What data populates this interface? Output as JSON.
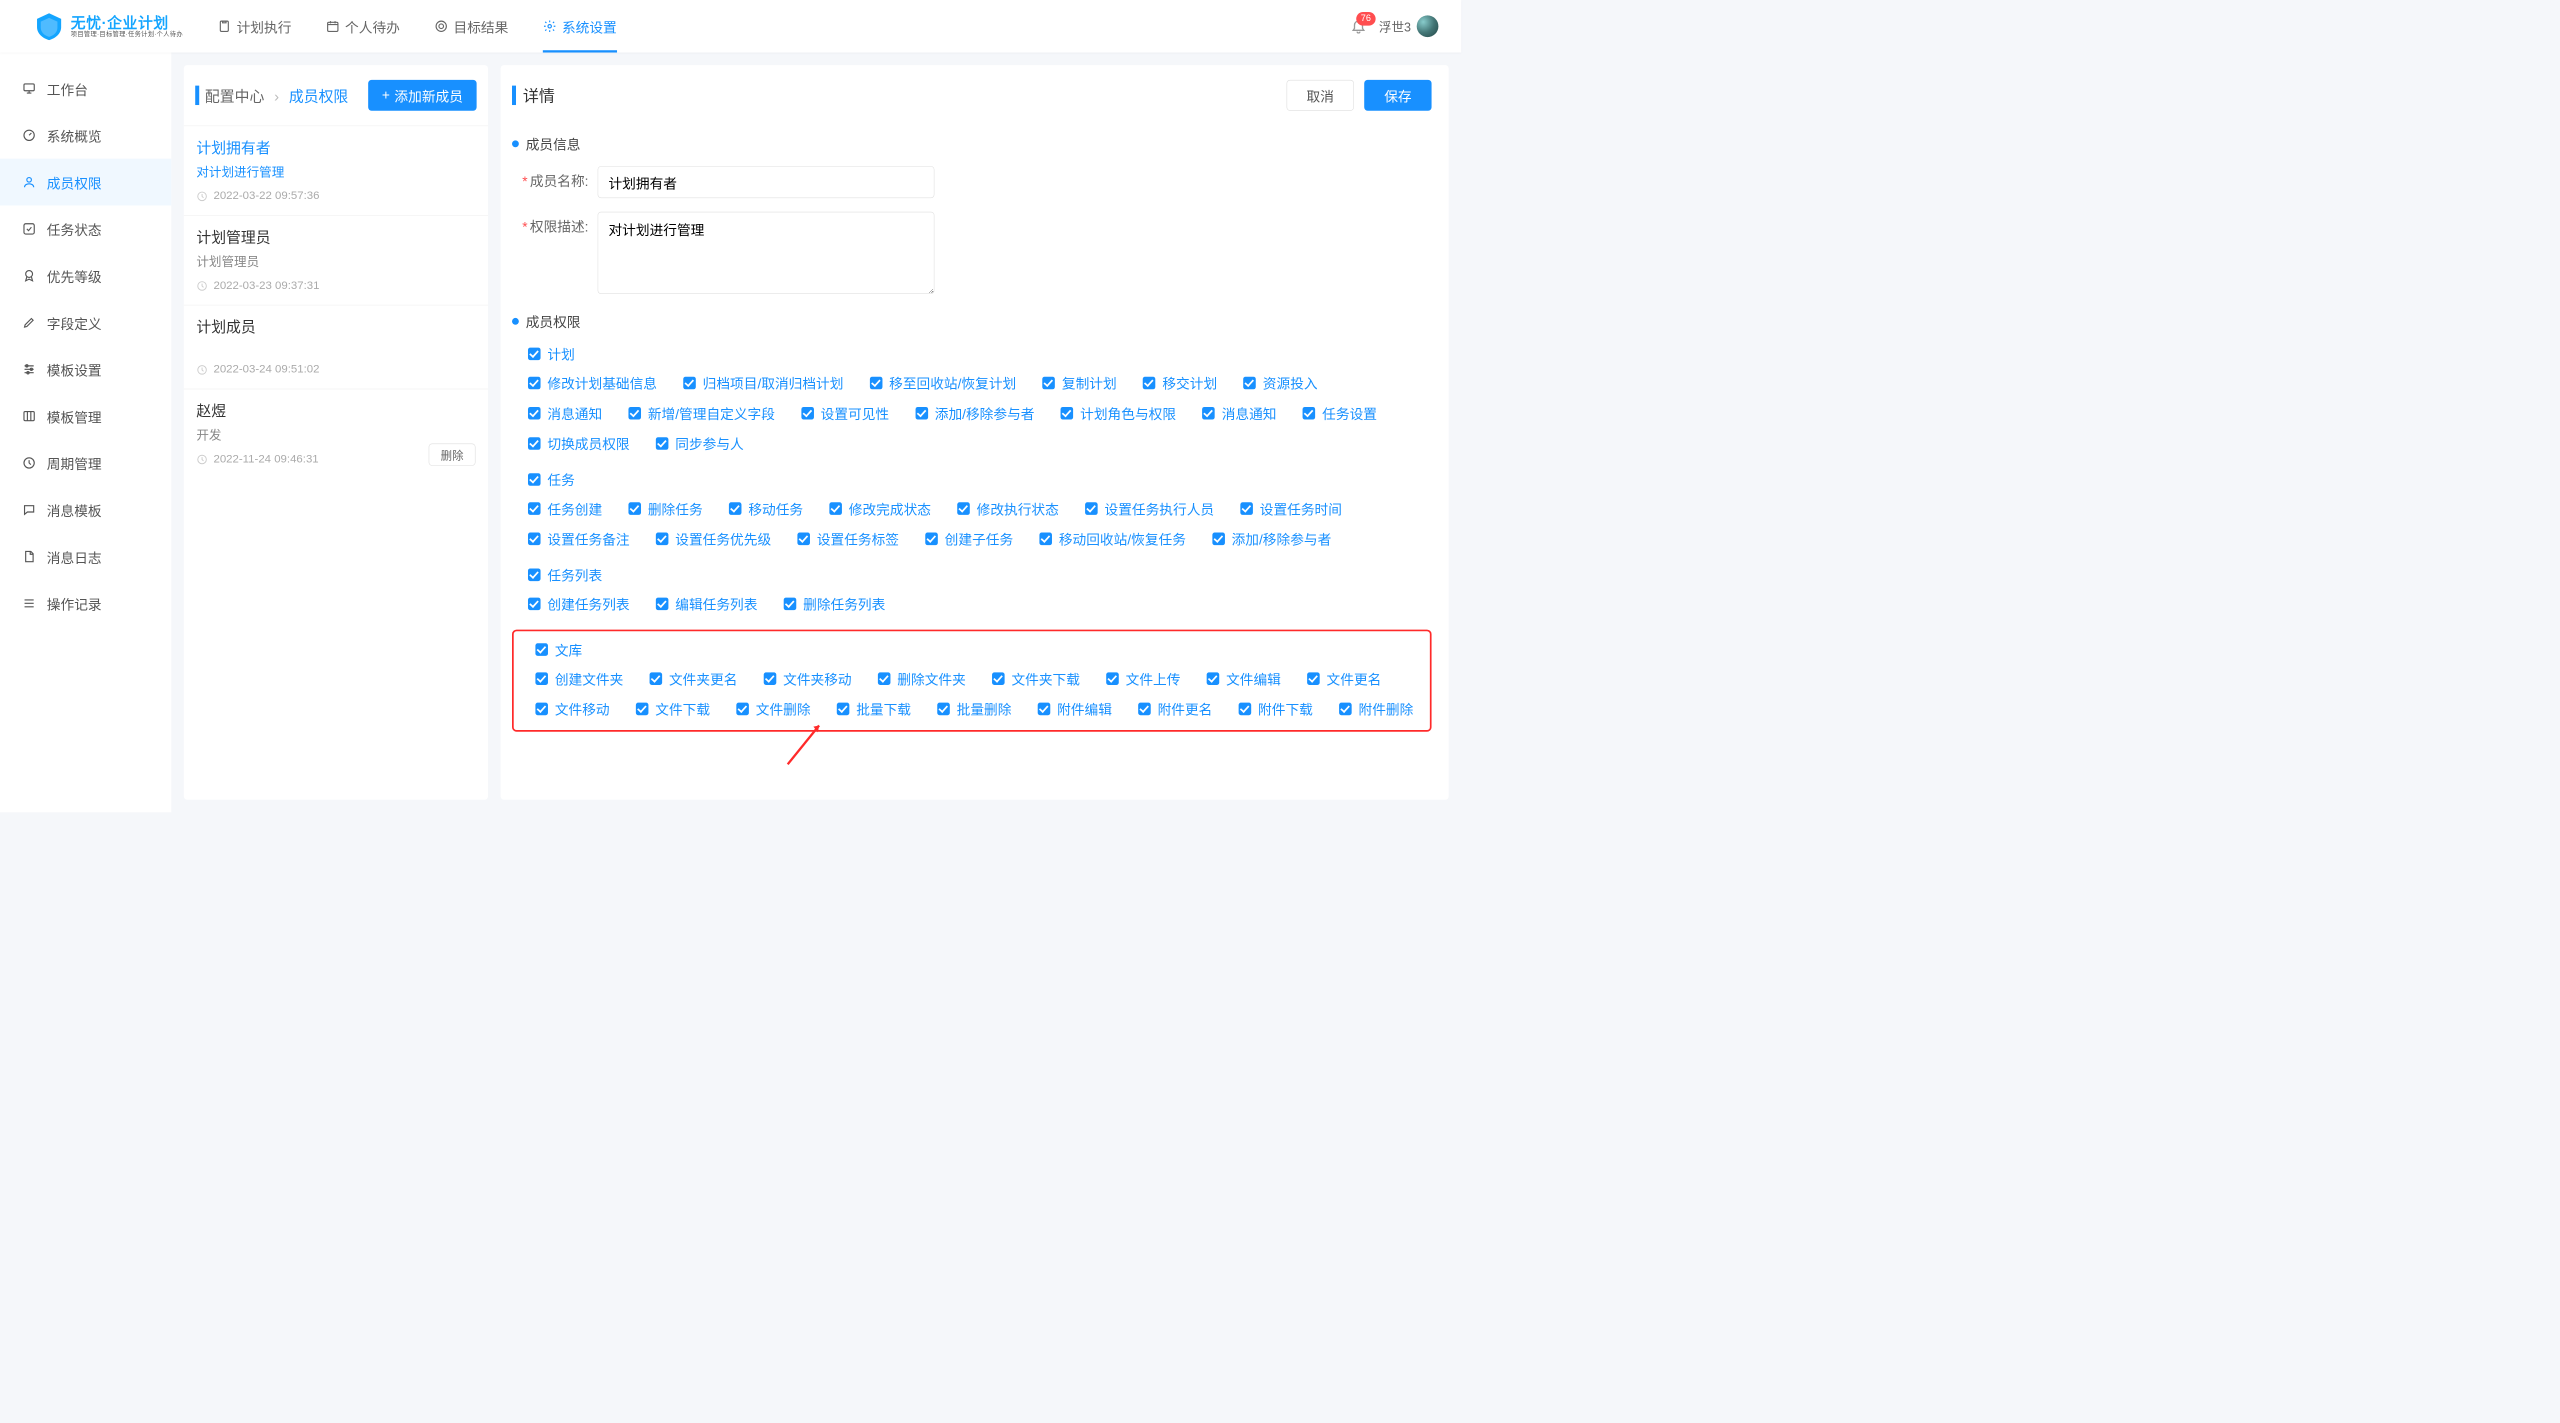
{
  "accent": "#1890ff",
  "logo": {
    "brand": "无忧·企业计划",
    "tagline": "项目管理·目标管理·任务计划·个人待办"
  },
  "topTabs": [
    {
      "id": "plan-exec",
      "label": "计划执行"
    },
    {
      "id": "personal",
      "label": "个人待办"
    },
    {
      "id": "okr",
      "label": "目标结果"
    },
    {
      "id": "settings",
      "label": "系统设置",
      "active": true
    }
  ],
  "notifications": {
    "count": "76"
  },
  "user": {
    "name": "浮世3"
  },
  "sidebar": [
    {
      "id": "workbench",
      "label": "工作台",
      "icon": "monitor"
    },
    {
      "id": "overview",
      "label": "系统概览",
      "icon": "dashboard"
    },
    {
      "id": "members",
      "label": "成员权限",
      "icon": "user",
      "active": true
    },
    {
      "id": "status",
      "label": "任务状态",
      "icon": "check-square"
    },
    {
      "id": "priority",
      "label": "优先等级",
      "icon": "medal"
    },
    {
      "id": "fields",
      "label": "字段定义",
      "icon": "pen"
    },
    {
      "id": "templates",
      "label": "模板设置",
      "icon": "sliders"
    },
    {
      "id": "tpl-mgmt",
      "label": "模板管理",
      "icon": "columns"
    },
    {
      "id": "cycles",
      "label": "周期管理",
      "icon": "clock"
    },
    {
      "id": "msg-tpl",
      "label": "消息模板",
      "icon": "chat"
    },
    {
      "id": "msg-log",
      "label": "消息日志",
      "icon": "doc"
    },
    {
      "id": "audit",
      "label": "操作记录",
      "icon": "list"
    }
  ],
  "listPanel": {
    "breadcrumbRoot": "配置中心",
    "breadcrumbCurrent": "成员权限",
    "addButton": "添加新成员",
    "deleteLabel": "删除",
    "roles": [
      {
        "title": "计划拥有者",
        "desc": "对计划进行管理",
        "date": "2022-03-22 09:57:36",
        "active": true
      },
      {
        "title": "计划管理员",
        "desc": "计划管理员",
        "date": "2022-03-23 09:37:31"
      },
      {
        "title": "计划成员",
        "desc": "",
        "date": "2022-03-24 09:51:02"
      },
      {
        "title": "赵煜",
        "desc": "开发",
        "date": "2022-11-24 09:46:31",
        "hover": true
      }
    ]
  },
  "detail": {
    "title": "详情",
    "cancel": "取消",
    "save": "保存",
    "sectionInfo": "成员信息",
    "sectionPerm": "成员权限",
    "nameLabel": "成员名称:",
    "descLabel": "权限描述:",
    "nameValue": "计划拥有者",
    "descValue": "对计划进行管理",
    "groups": [
      {
        "head": "计划",
        "rows": [
          [
            "修改计划基础信息",
            "归档项目/取消归档计划",
            "移至回收站/恢复计划",
            "复制计划",
            "移交计划",
            "资源投入"
          ],
          [
            "消息通知",
            "新增/管理自定义字段",
            "设置可见性",
            "添加/移除参与者",
            "计划角色与权限",
            "消息通知",
            "任务设置"
          ],
          [
            "切换成员权限",
            "同步参与人"
          ]
        ]
      },
      {
        "head": "任务",
        "rows": [
          [
            "任务创建",
            "删除任务",
            "移动任务",
            "修改完成状态",
            "修改执行状态",
            "设置任务执行人员",
            "设置任务时间"
          ],
          [
            "设置任务备注",
            "设置任务优先级",
            "设置任务标签",
            "创建子任务",
            "移动回收站/恢复任务",
            "添加/移除参与者"
          ]
        ]
      },
      {
        "head": "任务列表",
        "rows": [
          [
            "创建任务列表",
            "编辑任务列表",
            "删除任务列表"
          ]
        ]
      },
      {
        "head": "文库",
        "highlight": true,
        "rows": [
          [
            "创建文件夹",
            "文件夹更名",
            "文件夹移动",
            "删除文件夹",
            "文件夹下载",
            "文件上传",
            "文件编辑",
            "文件更名"
          ],
          [
            "文件移动",
            "文件下载",
            "文件删除",
            "批量下载",
            "批量删除",
            "附件编辑",
            "附件更名",
            "附件下载",
            "附件删除"
          ]
        ]
      }
    ]
  }
}
